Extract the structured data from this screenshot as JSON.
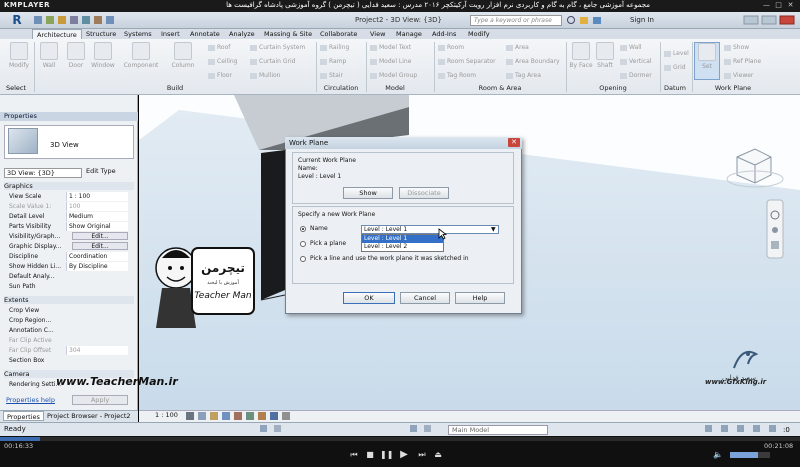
{
  "player": {
    "logo": "KMPLAYER",
    "title": "مجموعه آموزشی جامع ، گام به گام و کاربردی نرم افزار رویت آرکیتکچر ۲۰۱۶   مدرس : سعید فدایی ( تیچرمن ) گروه آموزشی پادشاه گرافیست ها",
    "elapsed": "00:16:33",
    "total": "00:21:08",
    "progress_fraction": 0.05
  },
  "revit": {
    "project_title": "Project2 - 3D View: {3D}",
    "search_placeholder": "Type a keyword or phrase",
    "sign_in": "Sign In",
    "tabs": [
      "Architecture",
      "Structure",
      "Systems",
      "Insert",
      "Annotate",
      "Analyze",
      "Massing & Site",
      "Collaborate",
      "View",
      "Manage",
      "Add-Ins",
      "Modify"
    ],
    "ribbon": {
      "modify": "Modify",
      "select": "Select",
      "build_buttons": [
        "Wall",
        "Door",
        "Window",
        "Component",
        "Column"
      ],
      "build_small": [
        "Roof",
        "Ceiling",
        "Floor",
        "Curtain System",
        "Curtain Grid",
        "Mullion",
        "Railing",
        "Ramp",
        "Stair"
      ],
      "model_small": [
        "Model Text",
        "Model Line",
        "Model Group"
      ],
      "room_small": [
        "Room",
        "Room Separator",
        "Tag Room",
        "Area",
        "Area Boundary",
        "Tag Area"
      ],
      "opening_small": [
        "By Face",
        "Shaft",
        "Wall",
        "Vertical",
        "Dormer"
      ],
      "datum_small": [
        "Level",
        "Grid"
      ],
      "workplane_big": "Set",
      "workplane_small": [
        "Show",
        "Ref Plane",
        "Viewer"
      ],
      "groups": [
        "Build",
        "Circulation",
        "Model",
        "Room & Area",
        "Opening",
        "Datum",
        "Work Plane"
      ]
    },
    "properties": {
      "header": "Properties",
      "type_name": "3D View",
      "selector": "3D View: {3D}",
      "edit_type": "Edit Type",
      "cat_graphics": "Graphics",
      "rows": [
        {
          "k": "View Scale",
          "v": "1 : 100"
        },
        {
          "k": "Scale Value    1:",
          "v": "100"
        },
        {
          "k": "Detail Level",
          "v": "Medium"
        },
        {
          "k": "Parts Visibility",
          "v": "Show Original"
        },
        {
          "k": "Visibility/Graph...",
          "v": "Edit..."
        },
        {
          "k": "Graphic Display...",
          "v": "Edit..."
        },
        {
          "k": "Discipline",
          "v": "Coordination"
        },
        {
          "k": "Show Hidden Li...",
          "v": "By Discipline"
        },
        {
          "k": "Default Analy...",
          "v": ""
        },
        {
          "k": "Sun Path",
          "v": ""
        }
      ],
      "cat_extents": "Extents",
      "ext_rows": [
        {
          "k": "Crop View",
          "v": ""
        },
        {
          "k": "Crop Region...",
          "v": ""
        },
        {
          "k": "Annotation C...",
          "v": ""
        },
        {
          "k": "Far Clip Active",
          "v": ""
        },
        {
          "k": "Far Clip Offset",
          "v": "304"
        },
        {
          "k": "Section Box",
          "v": ""
        }
      ],
      "cat_camera": "Camera",
      "cam_rows": [
        {
          "k": "Rendering Setti...",
          "v": ""
        }
      ],
      "help": "Properties help",
      "apply": "Apply"
    },
    "bottom_tabs": [
      "Properties",
      "Project Browser - Project2"
    ],
    "view_scale": "1 : 100",
    "status": "Ready",
    "main_model": "Main Model"
  },
  "dialog": {
    "title": "Work Plane",
    "current_heading": "Current Work Plane",
    "name_label": "Name:",
    "current_value": "Level : Level 1",
    "show": "Show",
    "dissociate": "Dissociate",
    "specify_heading": "Specify a new Work Plane",
    "opt_name": "Name",
    "opt_pick_plane": "Pick a plane",
    "opt_pick_line": "Pick a line and use the work plane it was sketched in",
    "name_selected": "Level : Level 1",
    "dropdown_options": [
      "Level : Level 1",
      "Level : Level 2"
    ],
    "ok": "OK",
    "cancel": "Cancel",
    "help": "Help"
  },
  "watermarks": {
    "teacherman_fa": "تیچرمن",
    "teacherman_sub": "آموزش با لبخند",
    "teacherman_en": "Teacher Man",
    "teacherman_url": "www.TeacherMan.ir",
    "gfx_name": "سعید فدایی",
    "gfx_url": "www.GfxKing.ir"
  }
}
